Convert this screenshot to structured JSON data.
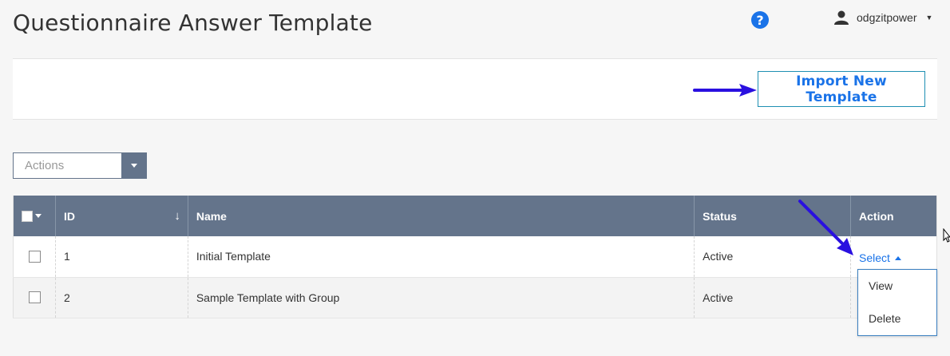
{
  "page": {
    "title": "Questionnaire Answer Template"
  },
  "header": {
    "help_icon": "question-circle",
    "user": {
      "name": "odgzitpower",
      "icon": "user-icon"
    }
  },
  "toolbar": {
    "import_label": "Import New Template"
  },
  "bulk_actions": {
    "placeholder": "Actions"
  },
  "table": {
    "columns": [
      "ID",
      "Name",
      "Status",
      "Action"
    ],
    "rows": [
      {
        "id": "1",
        "name": "Initial Template",
        "status": "Active",
        "action": "Select"
      },
      {
        "id": "2",
        "name": "Sample Template with Group",
        "status": "Active",
        "action": ""
      }
    ]
  },
  "action_menu": {
    "items": [
      "View",
      "Delete"
    ]
  },
  "colors": {
    "accent": "#1a73e8",
    "header_bg": "#64748b",
    "annotation_arrow": "#2a10e0"
  }
}
